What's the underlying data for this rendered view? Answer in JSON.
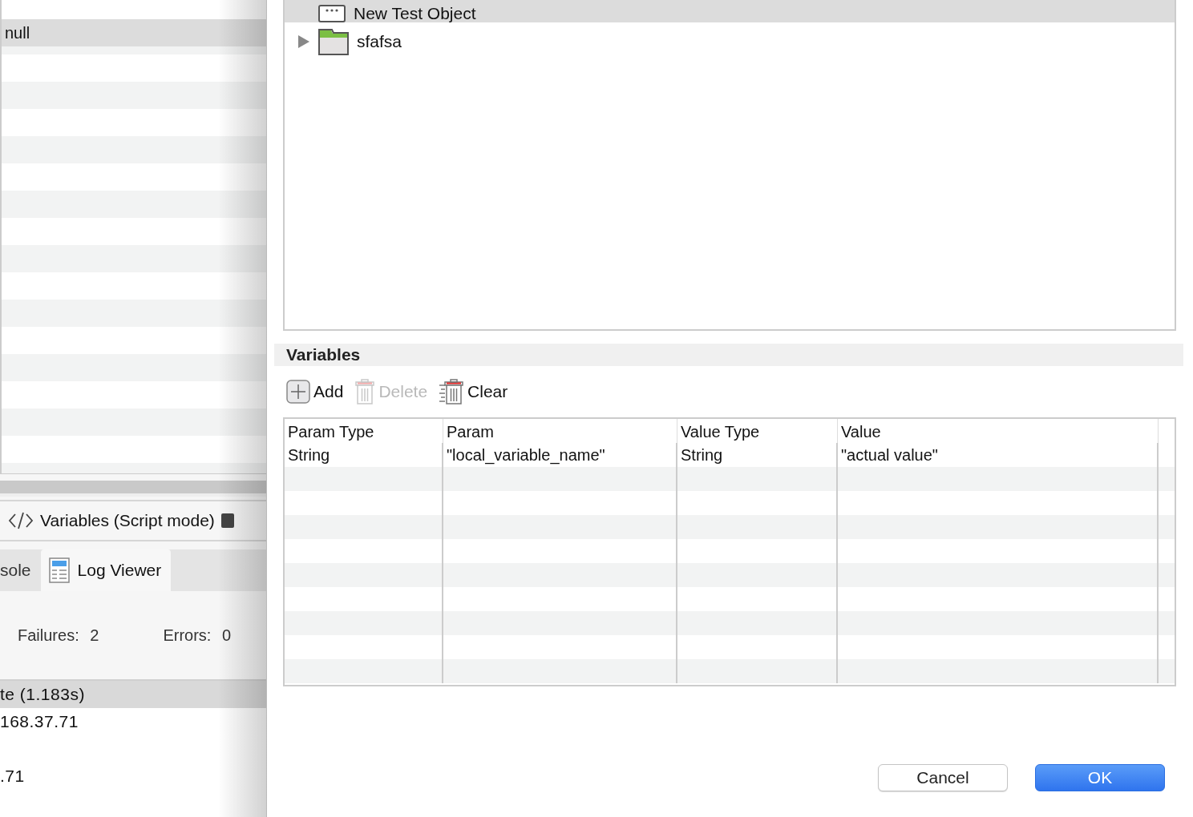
{
  "background_window": {
    "list_rows": [
      {
        "text": "null",
        "selected": true
      }
    ],
    "variables_view": {
      "label": "Variables (Script mode)"
    },
    "tabs": [
      {
        "label": "sole",
        "selected": false
      },
      {
        "label": "Log Viewer",
        "selected": true
      }
    ],
    "summary": [
      {
        "label": "Failures:",
        "value": "2"
      },
      {
        "label": "Errors:",
        "value": "0"
      }
    ],
    "log_rows": [
      {
        "text": "te (1.183s)",
        "selected": true
      },
      {
        "text": "168.37.71",
        "selected": false
      },
      {
        "text": ".71",
        "selected": false
      }
    ]
  },
  "dialog": {
    "tree": [
      {
        "label": "New Test Object",
        "kind": "object",
        "selected": true,
        "expandable": false
      },
      {
        "label": "sfafsa",
        "kind": "folder",
        "selected": false,
        "expandable": true
      }
    ],
    "variables": {
      "title": "Variables",
      "toolbar": [
        {
          "label": "Add",
          "kind": "add",
          "disabled": false
        },
        {
          "label": "Delete",
          "kind": "delete",
          "disabled": true
        },
        {
          "label": "Clear",
          "kind": "clear",
          "disabled": false
        }
      ],
      "columns": [
        "Param Type",
        "Param",
        "Value Type",
        "Value"
      ],
      "rows": [
        [
          "String",
          "\"local_variable_name\"",
          "String",
          "\"actual value\""
        ]
      ]
    },
    "buttons": [
      {
        "label": "Cancel",
        "kind": "secondary"
      },
      {
        "label": "OK",
        "kind": "primary"
      }
    ]
  }
}
